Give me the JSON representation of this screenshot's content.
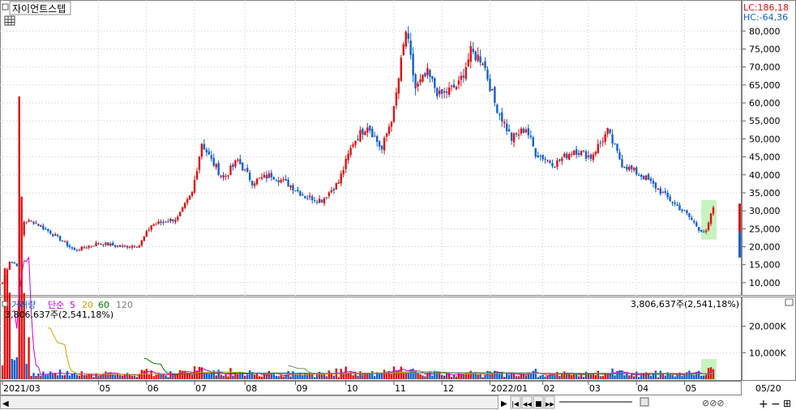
{
  "window": {
    "title": "자이언트스텝",
    "menu_icon": "menu-square-icon",
    "grid_icon": "table-grid-icon"
  },
  "overlay": {
    "lc_label": "LC:186,18",
    "hc_label": "HC:-64,36"
  },
  "volume_panel": {
    "title": "거래량",
    "ma_label": "단순",
    "ma_periods": [
      "5",
      "20",
      "60",
      "120"
    ],
    "ma_colors": [
      "#cc00cc",
      "#d4a000",
      "#008000",
      "#808080"
    ],
    "last_volume_label": "3,806,637주(2,541,18%)"
  },
  "colors": {
    "up": "#e01010",
    "down": "#1060d0",
    "highlight": "#b8f0b0",
    "grid": "#c8c8c8"
  },
  "navigation": {
    "date_label": "05/20",
    "buttons": [
      "◀",
      "▶",
      "|◀",
      "◀◀",
      "■",
      "▶▶",
      "+",
      "−",
      "⊞"
    ]
  },
  "chart_data": [
    {
      "type": "candlestick",
      "title": "자이언트스텝",
      "ylim": [
        7500,
        87500
      ],
      "y_ticks": [
        10000,
        15000,
        20000,
        25000,
        30000,
        35000,
        40000,
        45000,
        50000,
        55000,
        60000,
        65000,
        70000,
        75000,
        80000
      ],
      "y_tick_labels": [
        "10,000",
        "15,000",
        "20,000",
        "25,000",
        "30,000",
        "35,000",
        "40,000",
        "45,000",
        "50,000",
        "55,000",
        "60,000",
        "65,000",
        "70,000",
        "75,000",
        "80,000"
      ],
      "x_tick_labels": [
        "2021/03",
        "05",
        "06",
        "07",
        "08",
        "09",
        "10",
        "11",
        "12",
        "2022/01",
        "02",
        "03",
        "04",
        "05"
      ],
      "x_tick_index": [
        0,
        40,
        60,
        80,
        101,
        122,
        143,
        163,
        183,
        203,
        225,
        244,
        264,
        284
      ],
      "close_anchors": [
        [
          0,
          10000
        ],
        [
          3,
          16000
        ],
        [
          6,
          15000
        ],
        [
          9,
          27000
        ],
        [
          13,
          27000
        ],
        [
          20,
          24000
        ],
        [
          30,
          19000
        ],
        [
          40,
          21000
        ],
        [
          50,
          20000
        ],
        [
          57,
          20500
        ],
        [
          62,
          26000
        ],
        [
          73,
          28000
        ],
        [
          79,
          35000
        ],
        [
          83,
          49000
        ],
        [
          87,
          44000
        ],
        [
          92,
          39000
        ],
        [
          98,
          44000
        ],
        [
          104,
          38000
        ],
        [
          112,
          40000
        ],
        [
          120,
          37000
        ],
        [
          126,
          34000
        ],
        [
          133,
          33000
        ],
        [
          140,
          38000
        ],
        [
          146,
          49000
        ],
        [
          152,
          54000
        ],
        [
          158,
          47000
        ],
        [
          163,
          58000
        ],
        [
          168,
          80000
        ],
        [
          172,
          64000
        ],
        [
          177,
          68000
        ],
        [
          182,
          62000
        ],
        [
          190,
          65000
        ],
        [
          195,
          74000
        ],
        [
          200,
          72000
        ],
        [
          205,
          60000
        ],
        [
          212,
          50000
        ],
        [
          218,
          53000
        ],
        [
          222,
          46000
        ],
        [
          230,
          43000
        ],
        [
          238,
          47000
        ],
        [
          245,
          45000
        ],
        [
          252,
          52000
        ],
        [
          258,
          43000
        ],
        [
          268,
          39000
        ],
        [
          278,
          33000
        ],
        [
          285,
          29000
        ],
        [
          290,
          25000
        ],
        [
          293,
          24000
        ],
        [
          296,
          31000
        ]
      ]
    },
    {
      "type": "bar",
      "title": "거래량",
      "ylim": [
        0,
        30000000
      ],
      "y_ticks": [
        10000000,
        20000000
      ],
      "y_tick_labels": [
        "10,000K",
        "20,000K"
      ],
      "last_value": 3806637
    }
  ]
}
